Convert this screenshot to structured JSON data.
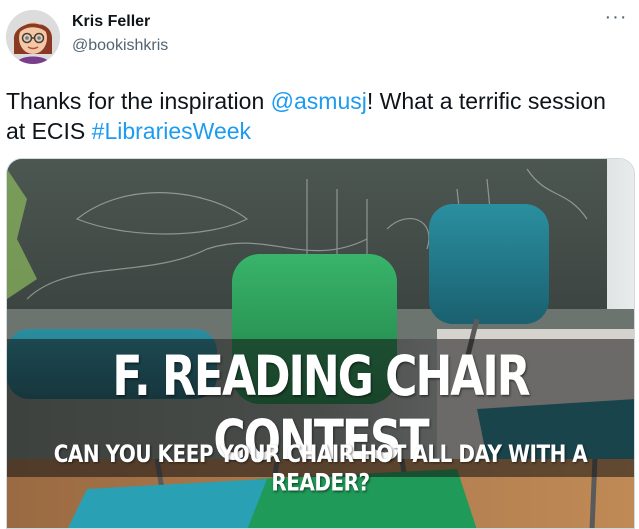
{
  "author": {
    "display_name": "Kris Feller",
    "handle": "@bookishkris",
    "avatar_icon": "cartoon-avatar-icon"
  },
  "more_icon": "more-options-icon",
  "more_label": "···",
  "tweet": {
    "text_before": "Thanks for the inspiration ",
    "mention": "@asmusj",
    "text_middle": "! What a terrific session at ECIS ",
    "hashtag": "#LibrariesWeek"
  },
  "media": {
    "title": "F. READING CHAIR CONTEST",
    "subtitle": "CAN YOU KEEP YOUR CHAIR HOT ALL DAY WITH A READER?"
  },
  "colors": {
    "link": "#1d9bf0",
    "text": "#0f1419",
    "secondary": "#536471"
  }
}
